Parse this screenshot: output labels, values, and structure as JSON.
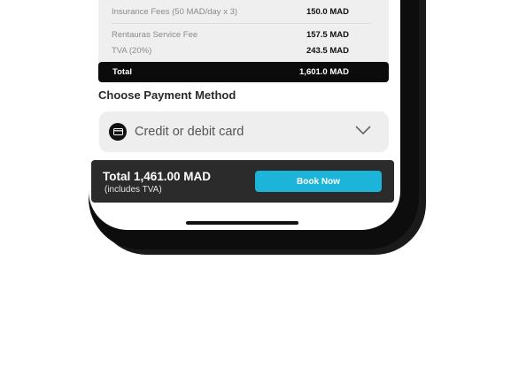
{
  "summary": {
    "insurance_label": "Insurance  Fees  (50 MAD/day x 3)",
    "insurance_value": "150.0 MAD",
    "service_label": "Rentauras Service Fee",
    "service_value": "157.5 MAD",
    "tva_label": "TVA (20%)",
    "tva_value": "243.5 MAD",
    "total_label": "Total",
    "total_value": "1,601.0 MAD"
  },
  "payment": {
    "section_title": "Choose Payment Method",
    "selected_method": "Credit or debit card",
    "icon": "credit-card-icon",
    "dropdown_icon": "chevron-down-icon"
  },
  "checkout": {
    "total_text": "Total 1,461.00 MAD",
    "note": "(includes TVA)",
    "book_label": "Book Now",
    "button_color": "#1cb4d8"
  }
}
